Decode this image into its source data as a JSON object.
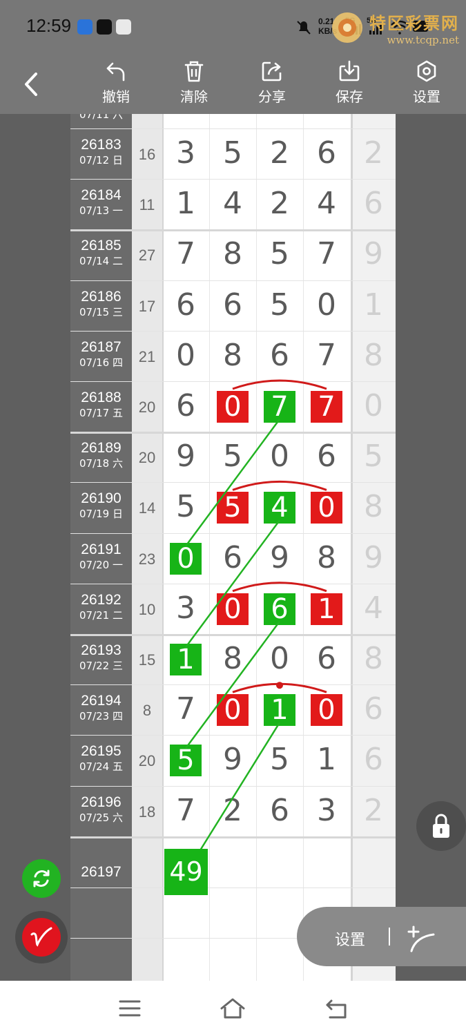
{
  "status_bar": {
    "time": "12:59",
    "speed": "0.21",
    "speed_unit": "KB/s",
    "network": "5G",
    "network2": "5G"
  },
  "watermark": {
    "title": "特区彩票网",
    "url": "www.tcqp.net"
  },
  "toolbar": {
    "back_icon": "chevron-left-icon",
    "items": [
      {
        "label": "撤销",
        "icon": "undo-icon"
      },
      {
        "label": "清除",
        "icon": "trash-icon"
      },
      {
        "label": "分享",
        "icon": "share-icon"
      },
      {
        "label": "保存",
        "icon": "download-icon"
      },
      {
        "label": "设置",
        "icon": "hexagon-settings-icon"
      }
    ]
  },
  "partial_top_period": "07/11 六",
  "rows": [
    {
      "period": "26183",
      "date": "07/12 日",
      "sum": "16",
      "digits": [
        "3",
        "5",
        "2",
        "6"
      ],
      "extra": "2"
    },
    {
      "period": "26184",
      "date": "07/13 一",
      "sum": "11",
      "digits": [
        "1",
        "4",
        "2",
        "4"
      ],
      "extra": "6"
    },
    {
      "period": "26185",
      "date": "07/14 二",
      "sum": "27",
      "digits": [
        "7",
        "8",
        "5",
        "7"
      ],
      "extra": "9"
    },
    {
      "period": "26186",
      "date": "07/15 三",
      "sum": "17",
      "digits": [
        "6",
        "6",
        "5",
        "0"
      ],
      "extra": "1"
    },
    {
      "period": "26187",
      "date": "07/16 四",
      "sum": "21",
      "digits": [
        "0",
        "8",
        "6",
        "7"
      ],
      "extra": "8"
    },
    {
      "period": "26188",
      "date": "07/17 五",
      "sum": "20",
      "digits": [
        "6",
        "0",
        "7",
        "7"
      ],
      "extra": "0"
    },
    {
      "period": "26189",
      "date": "07/18 六",
      "sum": "20",
      "digits": [
        "9",
        "5",
        "0",
        "6"
      ],
      "extra": "5"
    },
    {
      "period": "26190",
      "date": "07/19 日",
      "sum": "14",
      "digits": [
        "5",
        "5",
        "4",
        "0"
      ],
      "extra": "8"
    },
    {
      "period": "26191",
      "date": "07/20 一",
      "sum": "23",
      "digits": [
        "0",
        "6",
        "9",
        "8"
      ],
      "extra": "9"
    },
    {
      "period": "26192",
      "date": "07/21 二",
      "sum": "10",
      "digits": [
        "3",
        "0",
        "6",
        "1"
      ],
      "extra": "4"
    },
    {
      "period": "26193",
      "date": "07/22 三",
      "sum": "15",
      "digits": [
        "1",
        "8",
        "0",
        "6"
      ],
      "extra": "8"
    },
    {
      "period": "26194",
      "date": "07/23 四",
      "sum": "8",
      "digits": [
        "7",
        "0",
        "1",
        "0"
      ],
      "extra": "6"
    },
    {
      "period": "26195",
      "date": "07/24 五",
      "sum": "20",
      "digits": [
        "5",
        "9",
        "5",
        "1"
      ],
      "extra": "6"
    },
    {
      "period": "26196",
      "date": "07/25 六",
      "sum": "18",
      "digits": [
        "7",
        "2",
        "6",
        "3"
      ],
      "extra": "2"
    }
  ],
  "next_row": {
    "period": "26197",
    "value": "49"
  },
  "colors": {
    "red_mark": "#e21a1a",
    "green_mark": "#17b417",
    "arc": "#d01a1a"
  },
  "floating": {
    "lock_icon": "lock-icon",
    "refresh_icon": "refresh-icon",
    "pen_icon": "pen-icon",
    "settings_label": "设置",
    "draw_line_icon": "draw-line-icon"
  },
  "navbar": {
    "menu_icon": "menu-icon",
    "home_icon": "home-icon",
    "back_icon": "back-icon"
  }
}
